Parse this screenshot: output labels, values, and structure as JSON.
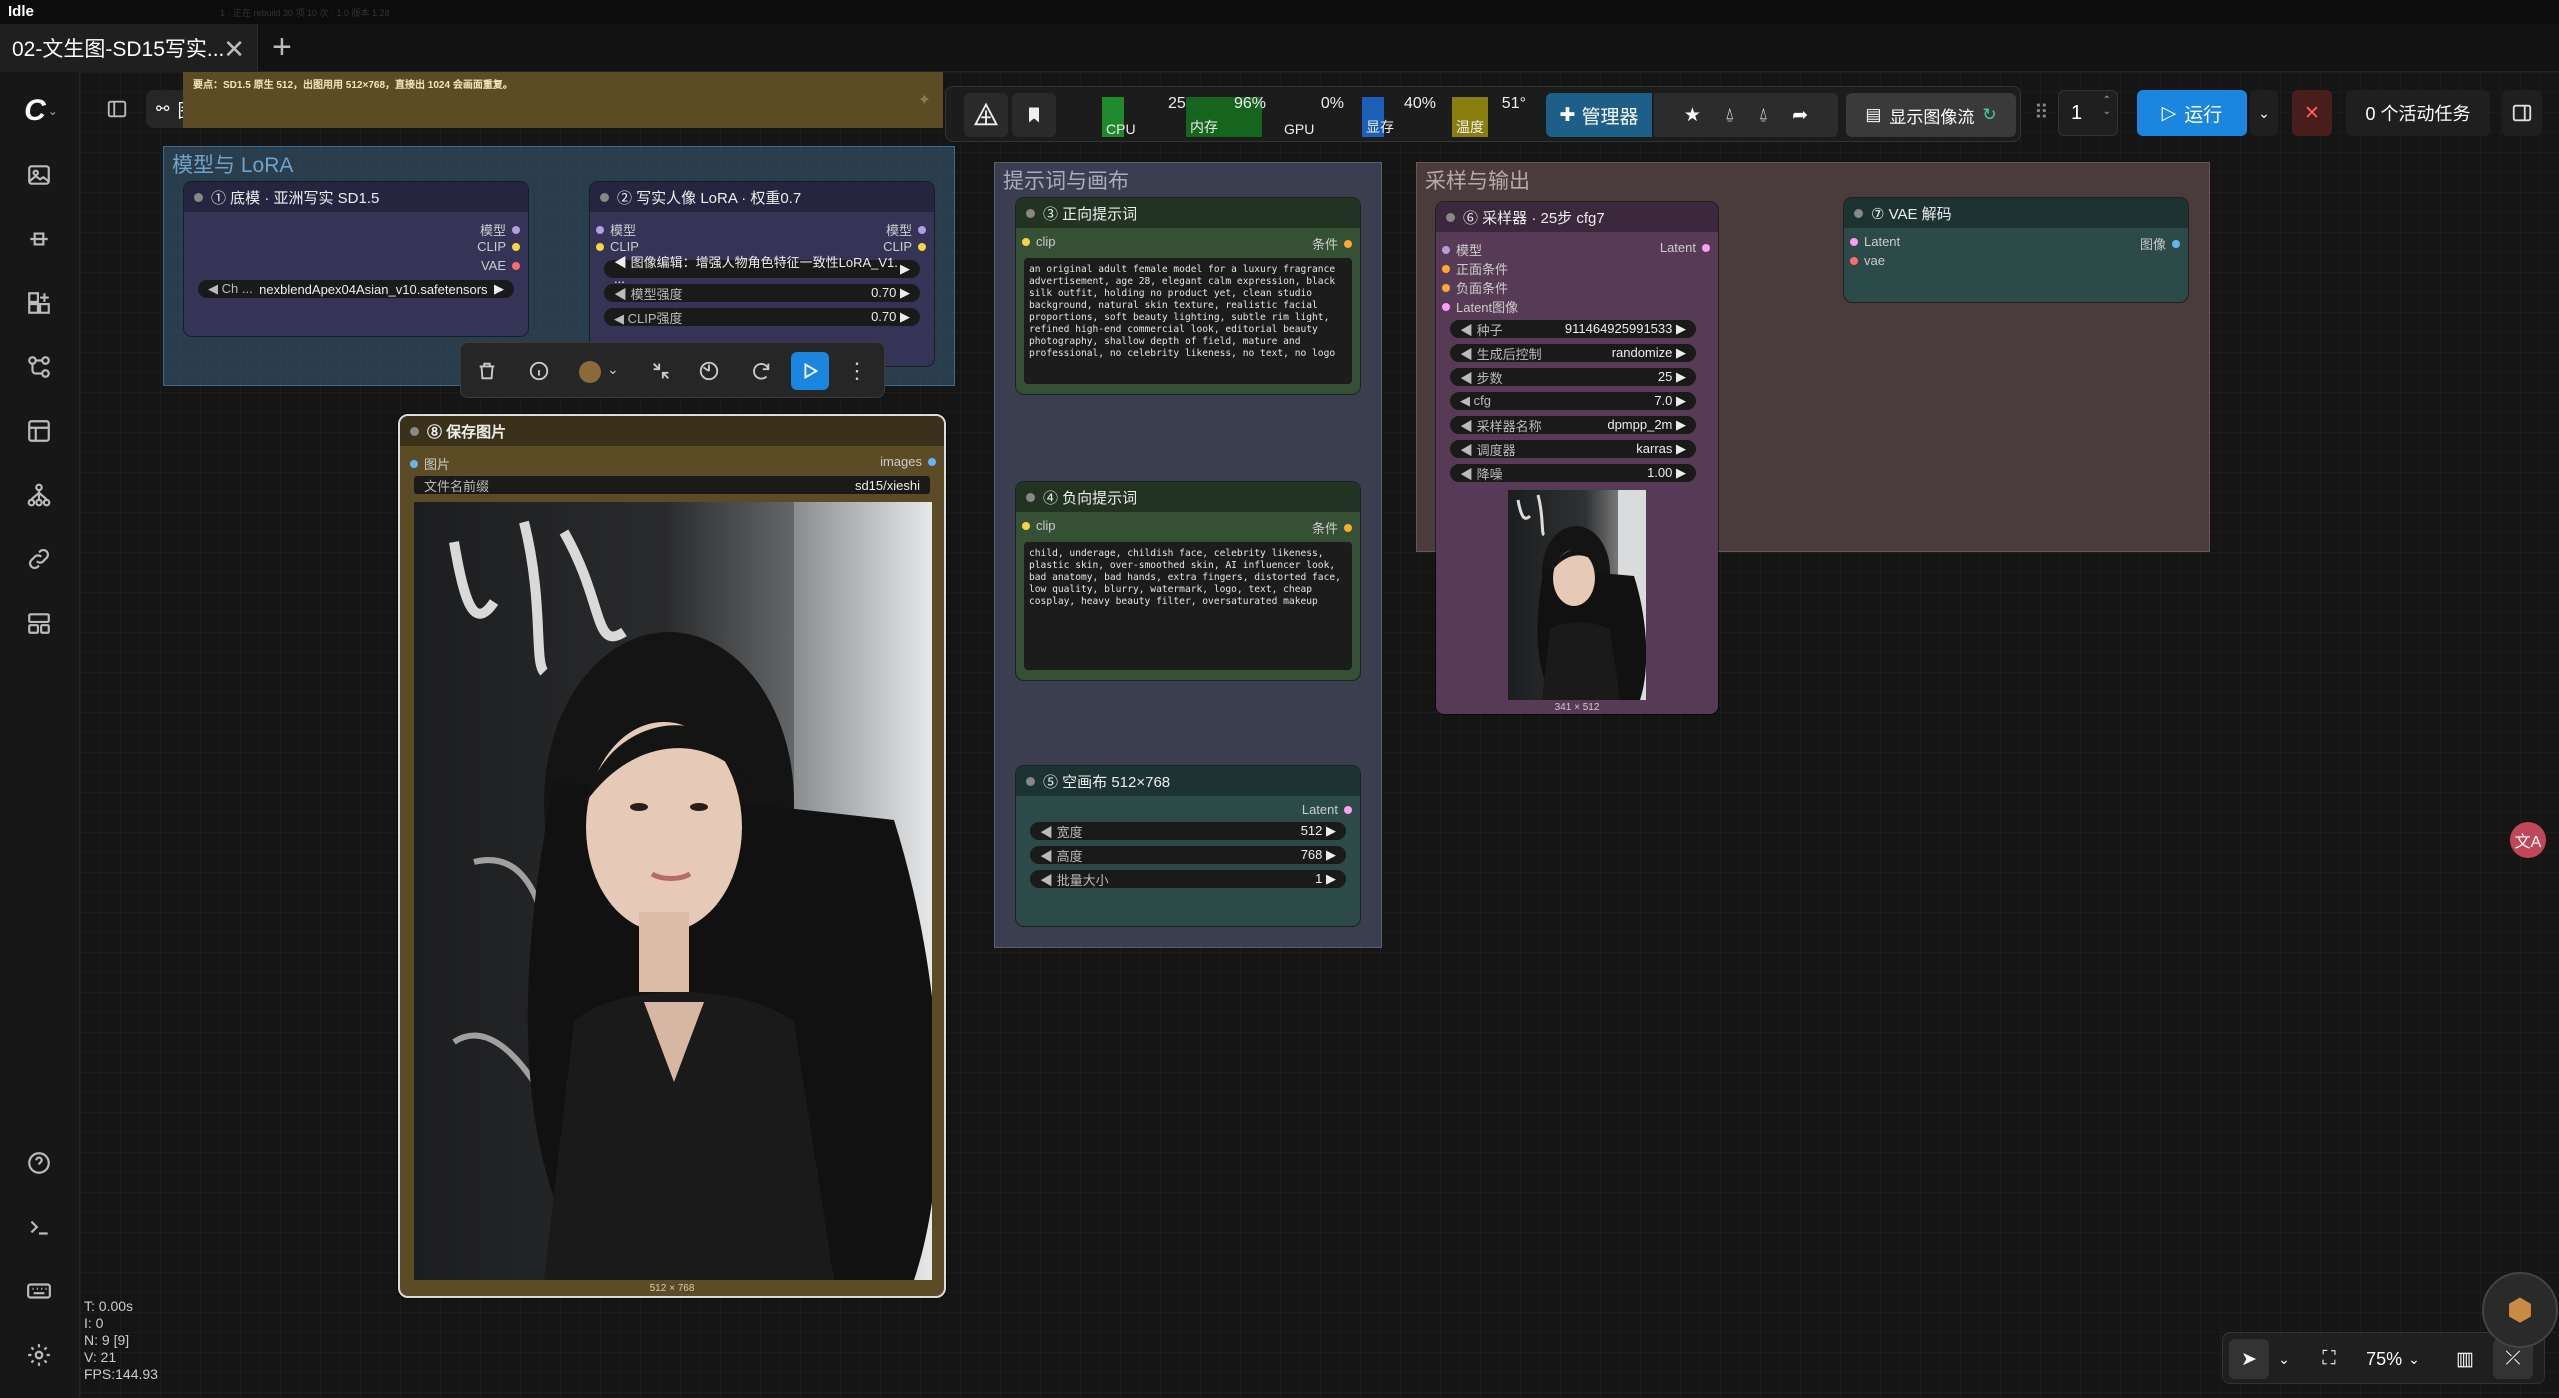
{
  "window": {
    "title": "Idle",
    "faint": "1 · 正在 rebuild 30 项 10 次 · 1.0 版本 1.28"
  },
  "tabs": {
    "active": "02-文生图-SD15写实...",
    "add": "+"
  },
  "graph_menu": {
    "label": "图形"
  },
  "note": {
    "text": "要点：SD1.5 原生 512，出图用用 512×768，直接出 1024 会画面重复。"
  },
  "groups": {
    "model_lora": "模型与 LoRA",
    "prompts": "提示词与画布",
    "sampling": "采样与输出"
  },
  "nodes": {
    "checkpoint": {
      "title": "① 底模 · 亚洲写实 SD1.5",
      "outputs": [
        "模型",
        "CLIP",
        "VAE"
      ],
      "ckpt_label": "Ch ...",
      "ckpt_value": "nexblendApex04Asian_v10.safetensors"
    },
    "lora": {
      "title": "② 写实人像 LoRA · 权重0.7",
      "inputs": [
        "模型",
        "CLIP"
      ],
      "outputs": [
        "模型",
        "CLIP"
      ],
      "lora_name": "图像编辑：增强人物角色特征一致性LoRA_V1. ...",
      "strength_model_label": "模型强度",
      "strength_model": "0.70",
      "strength_clip_label": "CLIP强度",
      "strength_clip": "0.70"
    },
    "positive": {
      "title": "③ 正向提示词",
      "input": "clip",
      "output": "条件",
      "text": "an original adult female model for a luxury fragrance advertisement, age 28, elegant calm expression, black silk outfit, holding no product yet, clean studio background, natural skin texture, realistic facial proportions, soft beauty lighting, subtle rim light, refined high-end commercial look, editorial beauty photography, shallow depth of field, mature and professional, no celebrity likeness, no text, no logo"
    },
    "negative": {
      "title": "④ 负向提示词",
      "input": "clip",
      "output": "条件",
      "text": "child, underage, childish face, celebrity likeness, plastic skin, over-smoothed skin, AI influencer look, bad anatomy, bad hands, extra fingers, distorted face, low quality, blurry, watermark, logo, text, cheap cosplay, heavy beauty filter, oversaturated makeup"
    },
    "latent": {
      "title": "⑤ 空画布 512×768",
      "output": "Latent",
      "width_label": "宽度",
      "width": "512",
      "height_label": "高度",
      "height": "768",
      "batch_label": "批量大小",
      "batch": "1"
    },
    "sampler": {
      "title": "⑥ 采样器 · 25步 cfg7",
      "inputs": [
        "模型",
        "正面条件",
        "负面条件",
        "Latent图像"
      ],
      "output": "Latent",
      "seed_label": "种子",
      "seed": "911464925991533",
      "control_label": "生成后控制",
      "control": "randomize",
      "steps_label": "步数",
      "steps": "25",
      "cfg_label": "cfg",
      "cfg": "7.0",
      "sampler_label": "采样器名称",
      "sampler": "dpmpp_2m",
      "scheduler_label": "调度器",
      "scheduler": "karras",
      "denoise_label": "降噪",
      "denoise": "1.00",
      "preview_size": "341 × 512"
    },
    "vae": {
      "title": "⑦ VAE 解码",
      "inputs": [
        "Latent",
        "vae"
      ],
      "output": "图像"
    },
    "save": {
      "title": "⑧ 保存图片",
      "input": "图片",
      "output": "images",
      "prefix_label": "文件名前缀",
      "prefix": "sd15/xieshi",
      "image_size": "512 × 768"
    }
  },
  "toolbar": {
    "cpu_label": "CPU",
    "cpu": "25%",
    "ram_label": "内存",
    "ram": "96%",
    "gpu_label": "GPU",
    "gpu": "0%",
    "vram_label": "显存",
    "vram": "40%",
    "temp_label": "温度",
    "temp": "51°",
    "manager": "管理器",
    "show_queue": "显示图像流",
    "batch_count": "1",
    "run": "运行",
    "active_tasks": "0 个活动任务",
    "colors": {
      "accent": "#1a86e0",
      "cpu": "#1f8a2c",
      "ram": "#15651f",
      "vram": "#1c5fb8",
      "temp": "#8a7d10"
    }
  },
  "stats": {
    "t": "T: 0.00s",
    "i": "I: 0",
    "n": "N: 9 [9]",
    "v": "V: 21",
    "fps": "FPS:144.93"
  },
  "zoom": {
    "level": "75%"
  }
}
